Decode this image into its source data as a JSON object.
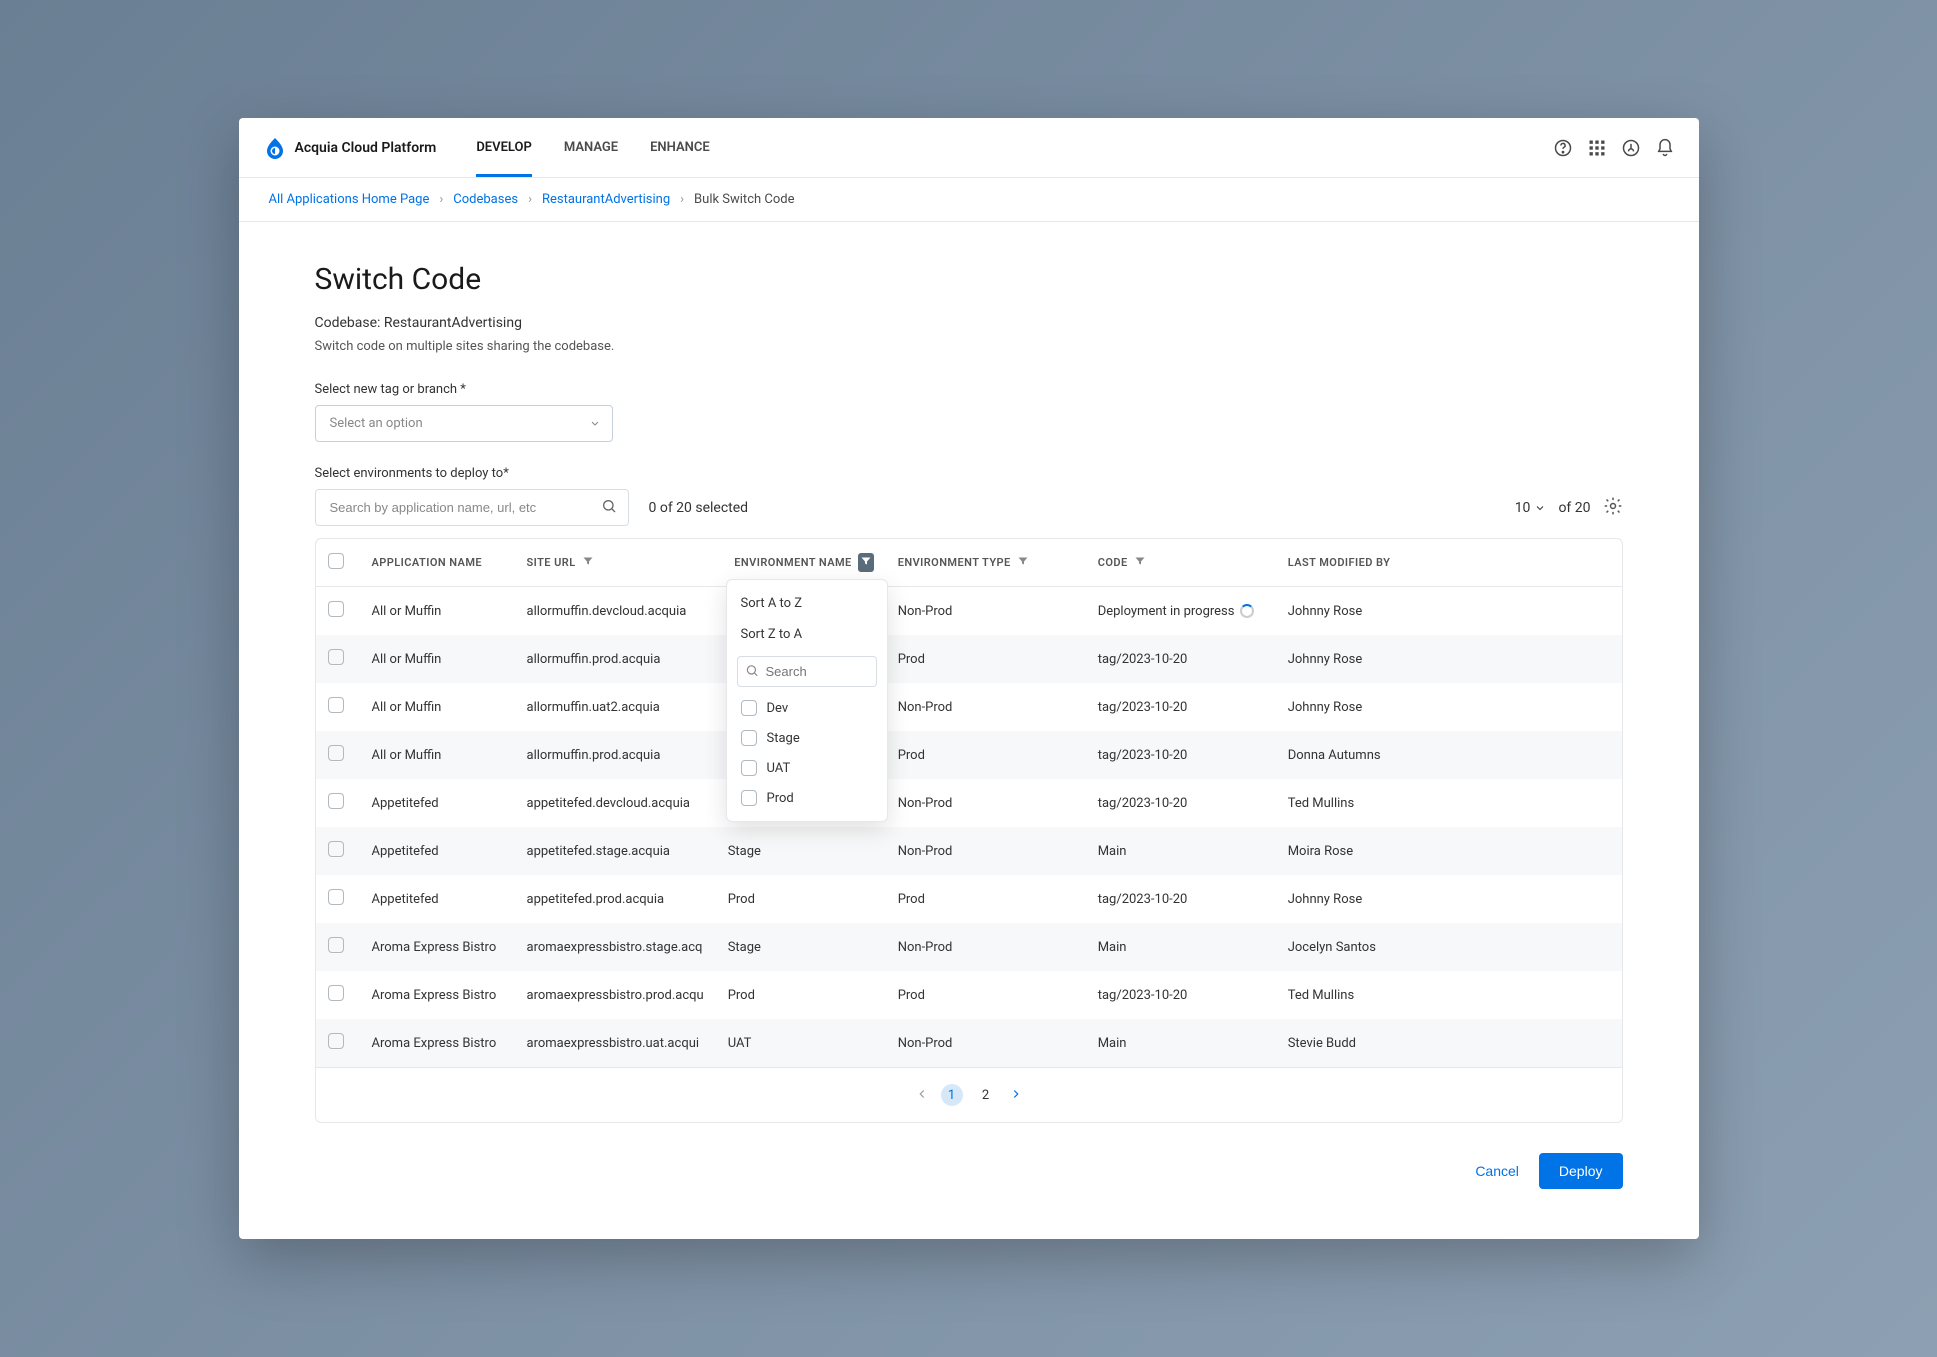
{
  "brand": "Acquia Cloud Platform",
  "nav": {
    "tabs": [
      "DEVELOP",
      "MANAGE",
      "ENHANCE"
    ],
    "activeIndex": 0
  },
  "breadcrumb": {
    "items": [
      {
        "label": "All Applications Home Page",
        "link": true
      },
      {
        "label": "Codebases",
        "link": true
      },
      {
        "label": "RestaurantAdvertising",
        "link": true
      },
      {
        "label": "Bulk Switch Code",
        "link": false
      }
    ]
  },
  "page": {
    "title": "Switch Code",
    "codebase_line": "Codebase: RestaurantAdvertising",
    "description": "Switch code on multiple sites sharing the codebase.",
    "select_label": "Select new tag or branch *",
    "select_placeholder": "Select an option",
    "environments_label": "Select environments to deploy to*",
    "search_placeholder": "Search by application name, url, etc",
    "selected_count": "0 of 20 selected",
    "pagesize": "10",
    "of_total": "of 20"
  },
  "table": {
    "headers": {
      "application": "APPLICATION NAME",
      "url": "SITE URL",
      "env_name": "ENVIRONMENT NAME",
      "env_type": "ENVIRONMENT TYPE",
      "code": "CODE",
      "modified": "LAST MODIFIED BY"
    },
    "rows": [
      {
        "app": "All or Muffin",
        "url": "allormuffin.devcloud.acquia",
        "env": "",
        "type": "Non-Prod",
        "code": "Deployment in progress",
        "code_spinner": true,
        "mod": "Johnny Rose"
      },
      {
        "app": "All or Muffin",
        "url": "allormuffin.prod.acquia",
        "env": "",
        "type": "Prod",
        "code": "tag/2023-10-20",
        "mod": "Johnny Rose"
      },
      {
        "app": "All or Muffin",
        "url": "allormuffin.uat2.acquia",
        "env": "",
        "type": "Non-Prod",
        "code": "tag/2023-10-20",
        "mod": "Johnny Rose"
      },
      {
        "app": "All or Muffin",
        "url": "allormuffin.prod.acquia",
        "env": "",
        "type": "Prod",
        "code": "tag/2023-10-20",
        "mod": "Donna Autumns"
      },
      {
        "app": "Appetitefed",
        "url": "appetitefed.devcloud.acquia",
        "env": "",
        "type": "Non-Prod",
        "code": "tag/2023-10-20",
        "mod": "Ted Mullins"
      },
      {
        "app": "Appetitefed",
        "url": "appetitefed.stage.acquia",
        "env": "Stage",
        "type": "Non-Prod",
        "code": "Main",
        "mod": "Moira Rose"
      },
      {
        "app": "Appetitefed",
        "url": "appetitefed.prod.acquia",
        "env": "Prod",
        "type": "Prod",
        "code": "tag/2023-10-20",
        "mod": "Johnny Rose"
      },
      {
        "app": "Aroma Express Bistro",
        "url": "aromaexpressbistro.stage.acq",
        "env": "Stage",
        "type": "Non-Prod",
        "code": "Main",
        "mod": "Jocelyn Santos"
      },
      {
        "app": "Aroma Express Bistro",
        "url": "aromaexpressbistro.prod.acqu",
        "env": "Prod",
        "type": "Prod",
        "code": "tag/2023-10-20",
        "mod": "Ted Mullins"
      },
      {
        "app": "Aroma Express Bistro",
        "url": "aromaexpressbistro.uat.acqui",
        "env": "UAT",
        "type": "Non-Prod",
        "code": "Main",
        "mod": "Stevie Budd"
      }
    ]
  },
  "filter_popover": {
    "sort_az": "Sort A to Z",
    "sort_za": "Sort Z to A",
    "search_placeholder": "Search",
    "options": [
      "Dev",
      "Stage",
      "UAT",
      "Prod"
    ]
  },
  "pagination": {
    "pages": [
      "1",
      "2"
    ],
    "activeIndex": 0
  },
  "buttons": {
    "cancel": "Cancel",
    "deploy": "Deploy"
  }
}
